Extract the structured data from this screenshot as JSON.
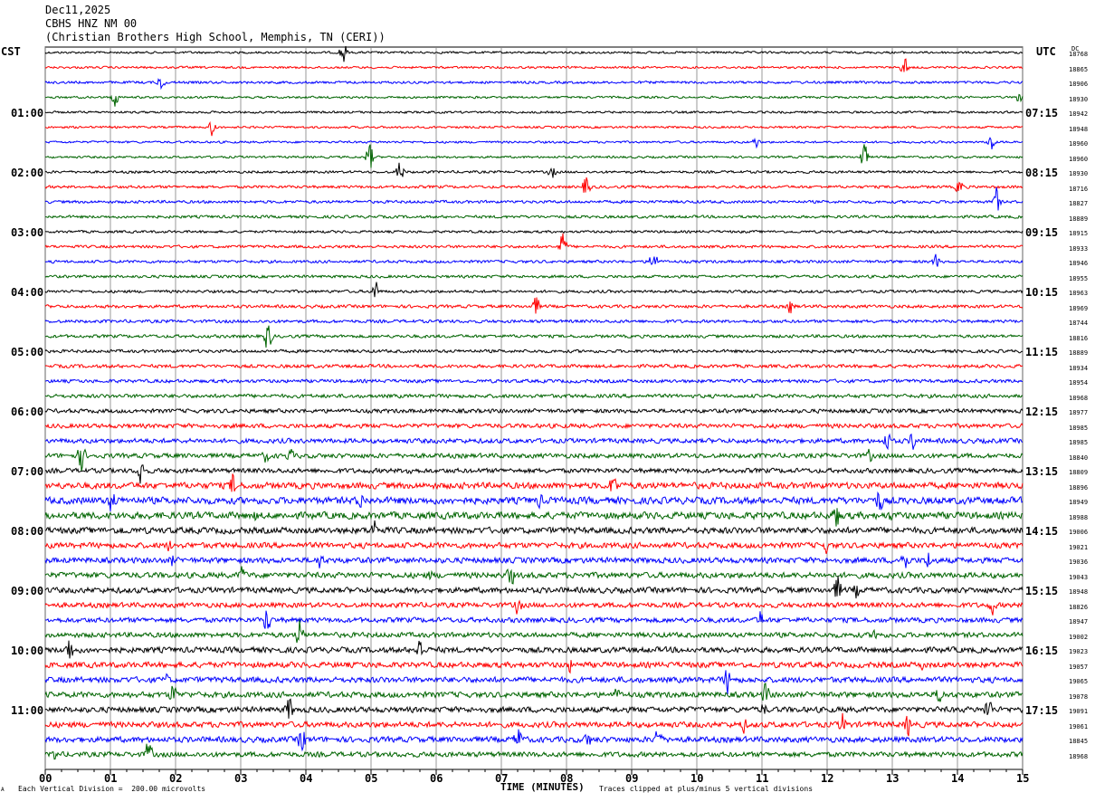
{
  "header": {
    "date": "Dec11,2025",
    "station": "CBHS HNZ NM 00",
    "location": "(Christian Brothers High School, Memphis, TN (CERI))"
  },
  "left_tz": "CST",
  "right_tz": "UTC",
  "dc_label": "DC",
  "footer": {
    "scale": "Each Vertical Division =  200.00 microvolts",
    "clip": "Traces clipped at plus/minus 5 vertical divisions",
    "mark": "A"
  },
  "colors": [
    "#000000",
    "#ff0000",
    "#0000ff",
    "#006400"
  ],
  "chart_data": {
    "type": "line",
    "title": "",
    "xlabel": "TIME (MINUTES)",
    "ylabel": "",
    "xlim": [
      0,
      15
    ],
    "x_ticks": [
      "00",
      "01",
      "02",
      "03",
      "04",
      "05",
      "06",
      "07",
      "08",
      "09",
      "10",
      "11",
      "12",
      "13",
      "14",
      "15"
    ],
    "left_hour_labels": [
      "01:00",
      "02:00",
      "03:00",
      "04:00",
      "05:00",
      "06:00",
      "07:00",
      "08:00",
      "09:00",
      "10:00",
      "11:00"
    ],
    "right_hour_labels": [
      "07:15",
      "08:15",
      "09:15",
      "10:15",
      "11:15",
      "12:15",
      "13:15",
      "14:15",
      "15:15",
      "16:15",
      "17:15"
    ],
    "trace_count": 48,
    "minutes_per_trace": 15,
    "dc_offsets": [
      18768,
      18865,
      18906,
      18930,
      18942,
      18948,
      18960,
      18960,
      18930,
      18716,
      18827,
      18889,
      18915,
      18933,
      18946,
      18955,
      18963,
      18969,
      18744,
      18816,
      18889,
      18934,
      18954,
      18968,
      18977,
      18985,
      18985,
      18840,
      18809,
      18896,
      18949,
      18988,
      19006,
      19021,
      19036,
      19043,
      18948,
      18826,
      18947,
      19002,
      19023,
      19057,
      19065,
      19078,
      19091,
      19061,
      18845,
      18968
    ],
    "noise_level": [
      0.7,
      0.7,
      0.8,
      0.7,
      0.7,
      0.7,
      0.7,
      0.7,
      0.8,
      0.9,
      0.9,
      0.9,
      0.8,
      0.9,
      0.9,
      0.9,
      0.9,
      1.0,
      1.0,
      1.0,
      1.0,
      1.1,
      1.1,
      1.2,
      1.3,
      1.4,
      1.5,
      1.5,
      1.5,
      2.0,
      2.2,
      2.2,
      2.0,
      1.8,
      1.8,
      1.8,
      1.8,
      1.6,
      1.6,
      1.6,
      1.8,
      1.8,
      1.8,
      1.8,
      1.8,
      1.8,
      1.8,
      1.6
    ]
  }
}
